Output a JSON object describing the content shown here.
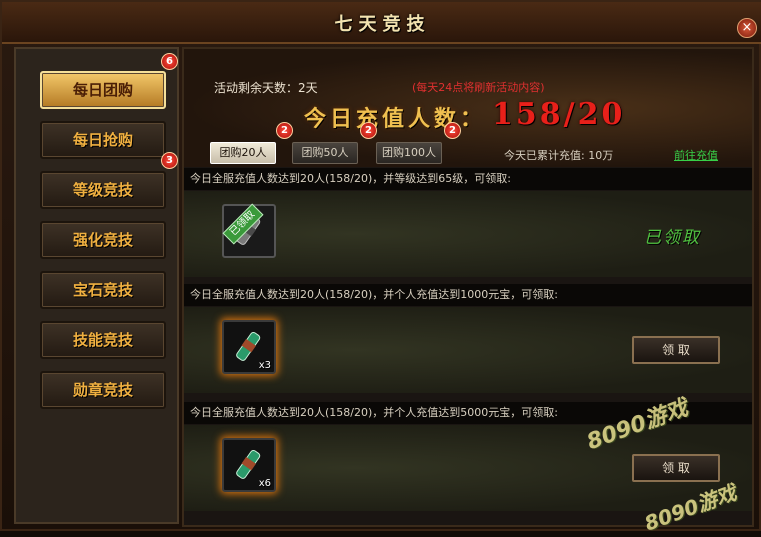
{
  "title": "七天竞技",
  "close_label": "×",
  "sidebar": {
    "items": [
      {
        "label": "每日团购",
        "badge": "6"
      },
      {
        "label": "每日抢购",
        "badge": ""
      },
      {
        "label": "等级竞技",
        "badge": "3"
      },
      {
        "label": "强化竞技",
        "badge": ""
      },
      {
        "label": "宝石竞技",
        "badge": ""
      },
      {
        "label": "技能竞技",
        "badge": ""
      },
      {
        "label": "勋章竞技",
        "badge": ""
      }
    ]
  },
  "banner": {
    "remaining": "活动剩余天数：2天",
    "refresh_note": "(每天24点将刷新活动内容)",
    "headline": "今日充值人数：",
    "counter": "158/20",
    "accumulated": "今天已累计充值:  10万",
    "recharge_link": "前往充值"
  },
  "tabs": [
    {
      "label": "团购20人",
      "badge": "2"
    },
    {
      "label": "团购50人",
      "badge": "2"
    },
    {
      "label": "团购100人",
      "badge": "2"
    }
  ],
  "rewards": [
    {
      "condition": "今日全服充值人数达到20人(158/20)，并等级达到65级，可领取:",
      "quantity": "",
      "claimed_tag": "已领取",
      "status": "已领取"
    },
    {
      "condition": "今日全服充值人数达到20人(158/20)，并个人充值达到1000元宝，可领取:",
      "quantity": "x3",
      "button": "领 取"
    },
    {
      "condition": "今日全服充值人数达到20人(158/20)，并个人充值达到5000元宝，可领取:",
      "quantity": "x6",
      "button": "领 取"
    }
  ],
  "watermark": {
    "text1": "8090",
    "text2": "游戏"
  },
  "colors": {
    "accent_gold": "#f0c050",
    "counter_red": "#e8201a",
    "link_green": "#38d048"
  }
}
